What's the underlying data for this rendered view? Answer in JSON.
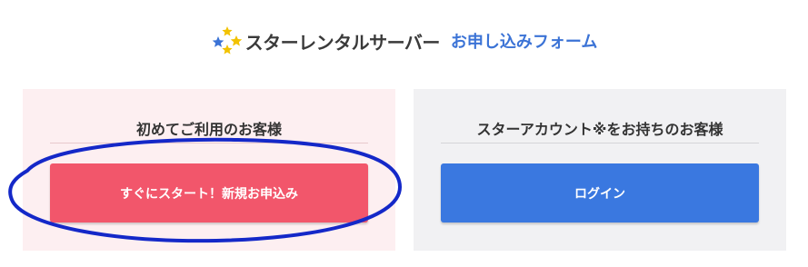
{
  "header": {
    "brand_name": "スターレンタルサーバー",
    "title": "お申し込みフォーム",
    "logo_icon": "stars-logo-icon"
  },
  "left_panel": {
    "heading": "初めてご利用のお客様",
    "button_label": "すぐにスタート！新規お申込み",
    "background": "#fdeff1",
    "button_color": "#f2566b"
  },
  "right_panel": {
    "heading": "スターアカウント※をお持ちのお客様",
    "button_label": "ログイン",
    "background": "#f1f1f3",
    "button_color": "#3a78e0"
  },
  "annotation": {
    "type": "ellipse-highlight",
    "color": "#1428c8"
  }
}
